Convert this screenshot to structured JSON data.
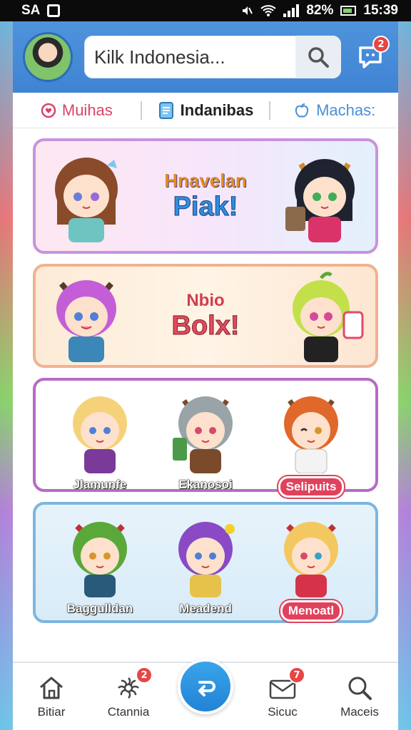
{
  "status_bar": {
    "carrier": "SA",
    "battery": "82%",
    "time": "15:39"
  },
  "header": {
    "search": {
      "value": "Kilk  Indonesia..."
    },
    "chat_badge": "2"
  },
  "tabs": [
    {
      "label": "Muihas",
      "icon": "heart-icon"
    },
    {
      "label": "Indanibas",
      "icon": "book-icon"
    },
    {
      "label": "Machas:",
      "icon": "apple-icon"
    }
  ],
  "cards": {
    "card1": {
      "line1": "Hnavelan",
      "line2": "Piak!"
    },
    "card2": {
      "line1": "Nbio",
      "line2": "Bolx!"
    },
    "card3": {
      "names": [
        "Jlamunfe",
        "Ekanosoi",
        "Selipuits"
      ]
    },
    "card4": {
      "names": [
        "Baggulldan",
        "Meadend",
        "Menoatl"
      ]
    }
  },
  "bottom_nav": [
    {
      "label": "Bitiar",
      "icon": "home-icon"
    },
    {
      "label": "Ctannia",
      "icon": "flower-icon",
      "badge": "2"
    },
    {
      "label": "",
      "icon": "share-icon"
    },
    {
      "label": "Sicuc",
      "icon": "mail-icon",
      "badge": "7"
    },
    {
      "label": "Maceis",
      "icon": "search-icon"
    }
  ],
  "colors": {
    "header": "#3f84d4",
    "badge": "#e64646",
    "accent_pink": "#e0425c"
  }
}
